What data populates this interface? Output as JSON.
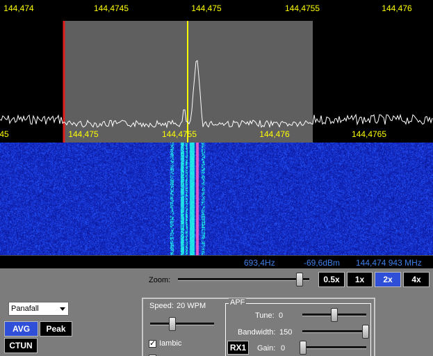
{
  "panadapter": {
    "top_scale": [
      "144,474",
      "144,4745",
      "144,475",
      "144,4755",
      "144,476"
    ],
    "bottom_scale": [
      "45",
      "144,475",
      "144,4755",
      "144,476",
      "144,4765"
    ],
    "colors": {
      "filter_band": "#5f5f5f",
      "tx_line": "#e11d1d",
      "vfo_line": "#ffff00",
      "trace": "#ffffff",
      "scale": "#ffff00"
    }
  },
  "status": {
    "offset": "693,4Hz",
    "level": "-69,6dBm",
    "frequency": "144,474 943 MHz"
  },
  "zoom": {
    "label": "Zoom:",
    "level": 0.93,
    "buttons": [
      {
        "label": "0.5x",
        "active": false
      },
      {
        "label": "1x",
        "active": false
      },
      {
        "label": "2x",
        "active": true
      },
      {
        "label": "4x",
        "active": false
      }
    ]
  },
  "display": {
    "mode": "Panafall",
    "avg_label": "AVG",
    "peak_label": "Peak",
    "ctun_label": "CTUN"
  },
  "cw": {
    "speed_label": "Speed:",
    "speed_value": "20 WPM",
    "speed_level": 0.35,
    "iambic_label": "Iambic",
    "iambic_checked": true
  },
  "apf": {
    "legend": "APF",
    "tune_label": "Tune:",
    "tune_value": "0",
    "tune_level": 0.5,
    "bandwidth_label": "Bandwidth:",
    "bandwidth_value": "150",
    "bandwidth_level": 1.0,
    "rx_label": "RX1",
    "gain_label": "Gain:",
    "gain_value": "0",
    "gain_level": 0.0
  }
}
